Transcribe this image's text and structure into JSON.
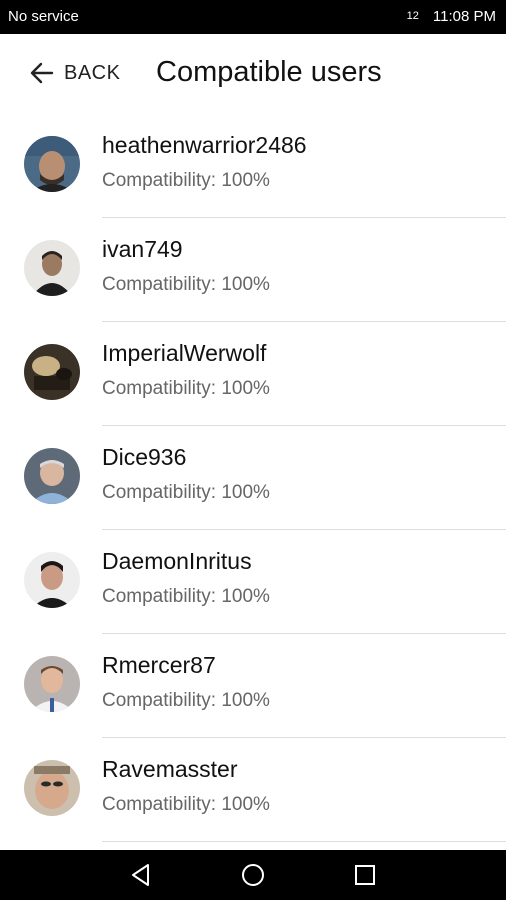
{
  "status_bar": {
    "carrier": "No service",
    "signal_small": "12",
    "time": "11:08 PM"
  },
  "header": {
    "back_label": "BACK",
    "title": "Compatible users"
  },
  "users": [
    {
      "name": "heathenwarrior2486",
      "compatibility": "Compatibility: 100%"
    },
    {
      "name": "ivan749",
      "compatibility": "Compatibility: 100%"
    },
    {
      "name": "ImperialWerwolf",
      "compatibility": "Compatibility: 100%"
    },
    {
      "name": "Dice936",
      "compatibility": "Compatibility: 100%"
    },
    {
      "name": "DaemonInritus",
      "compatibility": "Compatibility: 100%"
    },
    {
      "name": "Rmercer87",
      "compatibility": "Compatibility: 100%"
    },
    {
      "name": "Ravemasster",
      "compatibility": "Compatibility: 100%"
    }
  ],
  "nav": {
    "back_icon": "triangle-back-icon",
    "home_icon": "circle-home-icon",
    "recents_icon": "square-recents-icon"
  }
}
